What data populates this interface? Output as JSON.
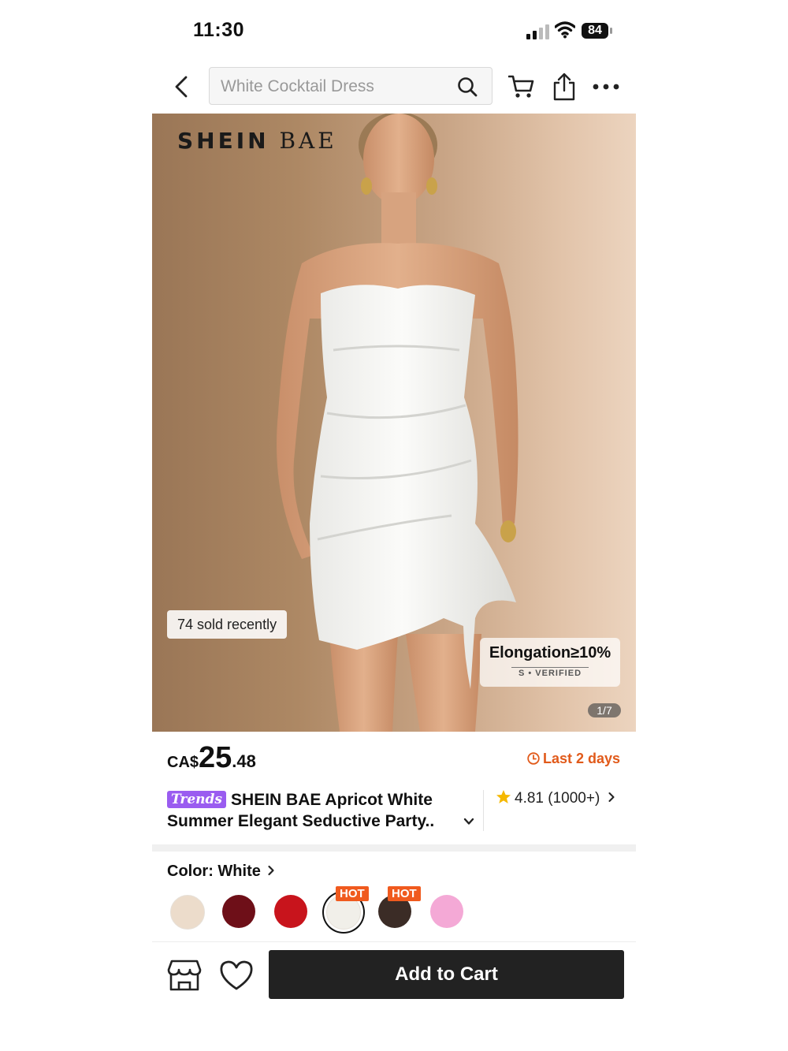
{
  "status_bar": {
    "time": "11:30",
    "battery": "84",
    "icons": [
      "signal-icon",
      "wifi-icon",
      "battery-icon"
    ]
  },
  "nav": {
    "search_placeholder": "White Cocktail Dress",
    "icons": [
      "back-icon",
      "search-icon",
      "cart-icon",
      "share-icon",
      "more-icon"
    ]
  },
  "hero": {
    "brand_part1": "SHEIN",
    "brand_part2": "BAE",
    "sold_recently": "74 sold recently",
    "badge_title": "Elongation≥10%",
    "badge_sub": "S • VERIFIED",
    "pager": "1/7"
  },
  "price": {
    "currency": "CA$",
    "whole": "25",
    "decimal": ".48",
    "promo": "Last 2 days"
  },
  "product": {
    "tag": "Trends",
    "title": "SHEIN BAE Apricot White Summer Elegant Seductive Party..",
    "rating": "4.81",
    "rating_count": "(1000+)"
  },
  "color": {
    "label": "Color: White",
    "selected_index": 3,
    "swatches": [
      {
        "color": "#ecdccb",
        "hot": false
      },
      {
        "color": "#6e0f18",
        "hot": false
      },
      {
        "color": "#c8141c",
        "hot": false
      },
      {
        "color": "#f1efe9",
        "hot": true
      },
      {
        "color": "#3b2c26",
        "hot": true
      },
      {
        "color": "#f4a9d6",
        "hot": false
      }
    ],
    "hot_label": "HOT"
  },
  "bottom": {
    "add_to_cart": "Add to Cart"
  },
  "colors": {
    "accent_orange": "#e15a1a",
    "hot_badge": "#f05a1e",
    "trends_purple": "#9a5cf0",
    "button_dark": "#222222",
    "star": "#f5b800"
  }
}
